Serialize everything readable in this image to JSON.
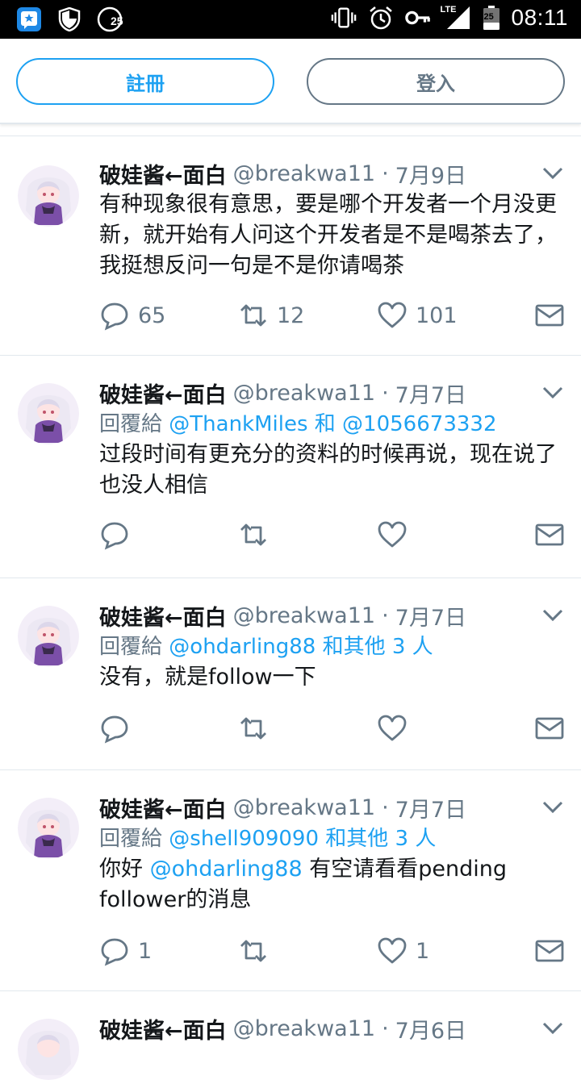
{
  "status_bar": {
    "time": "08:11",
    "network": "LTE",
    "notification_count": "25",
    "battery_level": "25"
  },
  "auth": {
    "signup_label": "註冊",
    "login_label": "登入"
  },
  "colors": {
    "accent": "#1da1f2",
    "muted": "#657786",
    "text": "#14171a"
  },
  "tweets": [
    {
      "name": "破娃酱←面白",
      "handle": "@breakwa11",
      "separator": "·",
      "date": "7月9日",
      "text": "有种现象很有意思，要是哪个开发者一个月没更新，就开始有人问这个开发者是不是喝茶去了，我挺想反问一句是不是你请喝茶",
      "reply_count": "65",
      "retweet_count": "12",
      "like_count": "101"
    },
    {
      "name": "破娃酱←面白",
      "handle": "@breakwa11",
      "separator": "·",
      "date": "7月7日",
      "replying_prefix": "回覆給",
      "replying_to": "@ThankMiles 和 @1056673332",
      "text": "过段时间有更充分的资料的时候再说，现在说了也没人相信"
    },
    {
      "name": "破娃酱←面白",
      "handle": "@breakwa11",
      "separator": "·",
      "date": "7月7日",
      "replying_prefix": "回覆給",
      "replying_to": "@ohdarling88 和其他 3 人",
      "text": "没有，就是follow一下"
    },
    {
      "name": "破娃酱←面白",
      "handle": "@breakwa11",
      "separator": "·",
      "date": "7月7日",
      "replying_prefix": "回覆給",
      "replying_to": "@shell909090 和其他 3 人",
      "text_mention": "@ohdarling88",
      "text_before": "你好 ",
      "text_after": " 有空请看看pending follower的消息",
      "reply_count": "1",
      "like_count": "1"
    },
    {
      "name": "破娃酱←面白",
      "handle": "@breakwa11",
      "separator": "·",
      "date": "7月6日"
    }
  ]
}
